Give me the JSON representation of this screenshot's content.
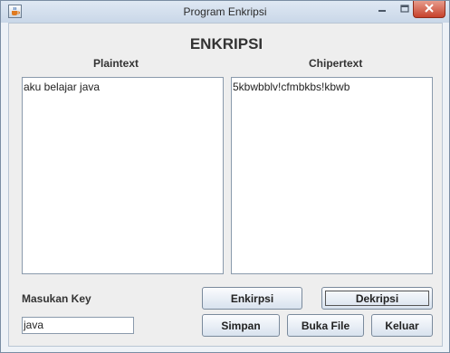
{
  "window": {
    "title": "Program Enkripsi"
  },
  "main": {
    "heading": "ENKRIPSI",
    "plaintext_label": "Plaintext",
    "chipertext_label": "Chipertext",
    "plaintext_value": "aku belajar java",
    "chipertext_value": "5kbwbblv!cfmbkbs!kbwb",
    "key_label": "Masukan Key",
    "key_value": "java"
  },
  "buttons": {
    "encrypt": "Enkirpsi",
    "decrypt": "Dekripsi",
    "save": "Simpan",
    "open_file": "Buka File",
    "exit": "Keluar"
  },
  "icons": {
    "app": "java-cup-icon",
    "minimize": "minimize-icon",
    "maximize": "maximize-icon",
    "close": "close-icon"
  },
  "colors": {
    "close_button": "#c7422c",
    "titlebar": "#c9d7e8"
  }
}
